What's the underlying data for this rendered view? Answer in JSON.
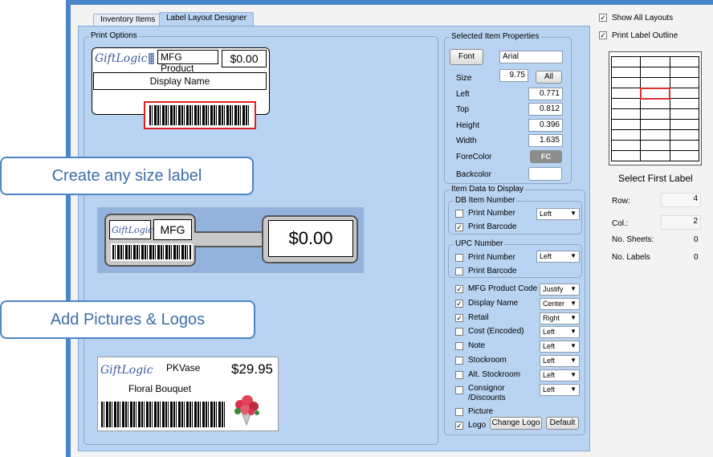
{
  "tabs": [
    {
      "label": "Inventory Items",
      "active": false
    },
    {
      "label": "Label Layout Designer",
      "active": true
    }
  ],
  "print_options": {
    "legend": "Print Options",
    "label1": {
      "logo_text": "GiftLogic",
      "mfg": "MFG Product",
      "price": "$0.00",
      "display_name": "Display Name"
    },
    "label2": {
      "logo_text": "GiftLogic",
      "mfg": "MFG",
      "price": "$0.00"
    },
    "label3": {
      "logo_text": "GiftLogic",
      "mfg": "PKVase",
      "price": "$29.95",
      "display_name": "Floral Bouquet",
      "picture": "flower-bouquet"
    }
  },
  "callouts": {
    "size": "Create any size label",
    "pictures": "Add Pictures & Logos"
  },
  "selected_props": {
    "legend": "Selected Item Properties",
    "font_button": "Font",
    "font_value": "Arial",
    "size_label": "Size",
    "size_value": "9.75",
    "all_button": "All",
    "left_label": "Left",
    "left_value": "0.771",
    "top_label": "Top",
    "top_value": "0.812",
    "height_label": "Height",
    "height_value": "0.396",
    "width_label": "Width",
    "width_value": "1.635",
    "forecolor_label": "ForeColor",
    "forecolor_button": "FC",
    "backcolor_label": "Backcolor"
  },
  "item_data": {
    "legend": "Item Data to Display",
    "db_item": {
      "legend": "DB Item Number",
      "print_number": "Print Number",
      "print_number_checked": false,
      "align": "Left",
      "print_barcode": "Print Barcode",
      "print_barcode_checked": true
    },
    "upc": {
      "legend": "UPC Number",
      "print_number": "Print Number",
      "print_number_checked": false,
      "align": "Left",
      "print_barcode": "Print Barcode",
      "print_barcode_checked": false
    },
    "fields": [
      {
        "label": "MFG Product Code",
        "checked": true,
        "align": "Justify"
      },
      {
        "label": "Display Name",
        "checked": true,
        "align": "Center"
      },
      {
        "label": "Retail",
        "checked": true,
        "align": "Right"
      },
      {
        "label": "Cost (Encoded)",
        "checked": false,
        "align": "Left"
      },
      {
        "label": "Note",
        "checked": false,
        "align": "Left"
      },
      {
        "label": "Stockroom",
        "checked": false,
        "align": "Left"
      },
      {
        "label": "Alt. Stockroom",
        "checked": false,
        "align": "Left"
      },
      {
        "label": "Consignor /Discounts",
        "checked": false,
        "align": "Left"
      }
    ],
    "picture_label": "Picture",
    "picture_checked": false,
    "logo_label": "Logo",
    "logo_checked": true,
    "change_logo_button": "Change Logo",
    "default_button": "Default"
  },
  "right_panel": {
    "show_all_layouts": "Show All Layouts",
    "show_all_checked": true,
    "print_label_outline": "Print Label Outline",
    "print_outline_checked": true,
    "select_first_label": "Select First Label",
    "row_label": "Row:",
    "row_value": "4",
    "col_label": "Col.:",
    "col_value": "2",
    "no_sheets_label": "No. Sheets:",
    "no_sheets_value": "0",
    "no_labels_label": "No. Labels",
    "no_labels_value": "0",
    "grid_rows": 10,
    "grid_cols": 3,
    "selected_row": 4,
    "selected_col": 2,
    "selected_color": "#e03030"
  },
  "colors": {
    "frame": "#4a86c8",
    "panel": "#b9d3f2",
    "callout_text": "#3c6fa8",
    "selected_barcode_border": "#e02020"
  }
}
